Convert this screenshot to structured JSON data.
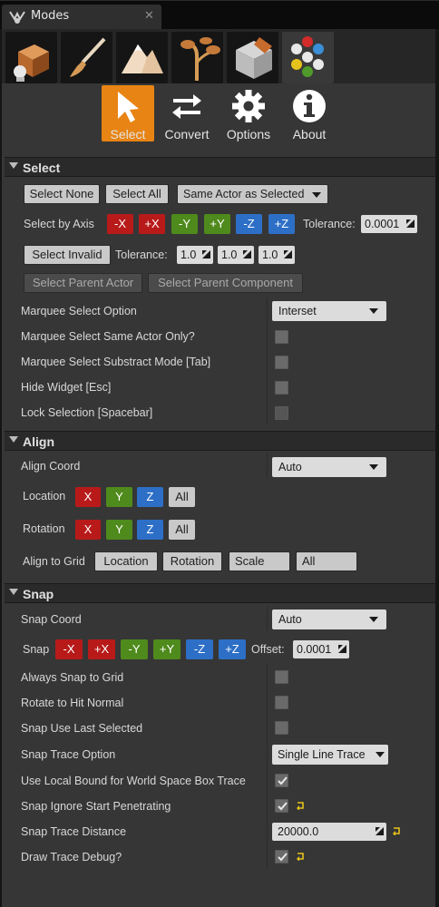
{
  "window": {
    "tab_title": "Modes",
    "close_glyph": "✕"
  },
  "tiles": [
    "place-mode-icon",
    "paint-mode-icon",
    "landscape-mode-icon",
    "foliage-mode-icon",
    "mesh-paint-mode-icon",
    "modes-plugin-icon"
  ],
  "header_buttons": {
    "select": "Select",
    "convert": "Convert",
    "options": "Options",
    "about": "About"
  },
  "select": {
    "title": "Select",
    "select_none": "Select None",
    "select_all": "Select All",
    "same_actor": "Same Actor as Selected",
    "select_by_axis": "Select by Axis",
    "axes": [
      "-X",
      "+X",
      "-Y",
      "+Y",
      "-Z",
      "+Z"
    ],
    "tolerance_label": "Tolerance:",
    "tolerance_value": "0.0001",
    "select_invalid": "Select Invalid",
    "tolerance2_label": "Tolerance:",
    "tolerance_xyz": [
      "1.0",
      "1.0",
      "1.0"
    ],
    "select_parent_actor": "Select Parent Actor",
    "select_parent_component": "Select Parent Component",
    "marquee_option_label": "Marquee Select Option",
    "marquee_option_value": "Interset",
    "same_actor_only_label": "Marquee Select Same Actor Only?",
    "substract_label": "Marquee Select Substract Mode [Tab]",
    "hide_widget_label": "Hide Widget [Esc]",
    "lock_selection_label": "Lock Selection [Spacebar]"
  },
  "align": {
    "title": "Align",
    "coord_label": "Align Coord",
    "coord_value": "Auto",
    "location_label": "Location",
    "rotation_label": "Rotation",
    "axis_letters": [
      "X",
      "Y",
      "Z",
      "All"
    ],
    "align_to_grid_label": "Align to Grid",
    "grid_buttons": [
      "Location",
      "Rotation",
      "Scale",
      "All"
    ]
  },
  "snap": {
    "title": "Snap",
    "coord_label": "Snap Coord",
    "coord_value": "Auto",
    "snap_label": "Snap",
    "axes": [
      "-X",
      "+X",
      "-Y",
      "+Y",
      "-Z",
      "+Z"
    ],
    "offset_label": "Offset:",
    "offset_value": "0.0001",
    "always_snap_label": "Always Snap to Grid",
    "rotate_hit_label": "Rotate to Hit Normal",
    "use_last_label": "Snap Use Last Selected",
    "trace_option_label": "Snap Trace Option",
    "trace_option_value": "Single Line Trace",
    "local_bound_label": "Use Local Bound for World Space Box Trace",
    "ignore_start_label": "Snap Ignore Start Penetrating",
    "trace_distance_label": "Snap Trace Distance",
    "trace_distance_value": "20000.0",
    "draw_debug_label": "Draw Trace Debug?"
  },
  "colors": {
    "accent": "#e88413",
    "axis_x": "#b81a1a",
    "axis_y": "#4f8a1d",
    "axis_z": "#2d6fc6",
    "reset_arrow": "#e6c21c"
  }
}
